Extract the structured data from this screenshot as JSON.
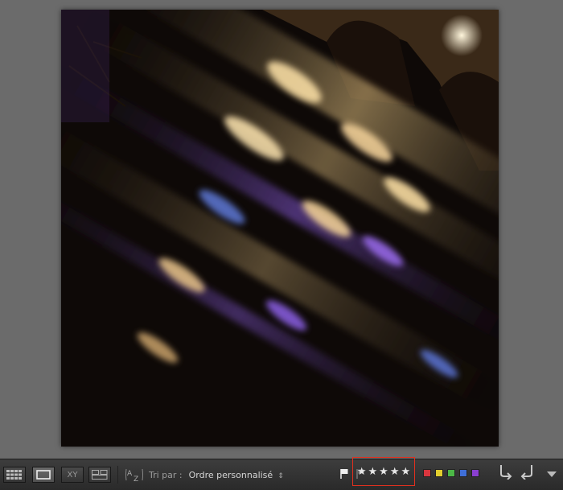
{
  "toolbar": {
    "sort_label": "Tri par :",
    "sort_value": "Ordre personnalisé",
    "compare_label": "XY",
    "rating_stars": [
      "★",
      "★",
      "★",
      "★",
      "★"
    ],
    "color_labels": [
      {
        "name": "red",
        "color": "#d9363e"
      },
      {
        "name": "yellow",
        "color": "#e2cf2e"
      },
      {
        "name": "green",
        "color": "#4cb847"
      },
      {
        "name": "blue",
        "color": "#3f6fd8"
      },
      {
        "name": "purple",
        "color": "#8a3fd1"
      }
    ],
    "icons": [
      "grid-view-icon",
      "loupe-view-icon",
      "compare-view-icon",
      "survey-view-icon",
      "sort-direction-icon",
      "flag-pick-icon",
      "flag-reject-icon",
      "rotate-left-icon",
      "rotate-right-icon",
      "toolbar-menu-icon"
    ]
  },
  "photo": {
    "subject": "night long-exposure reflections of bridge lights on water"
  }
}
